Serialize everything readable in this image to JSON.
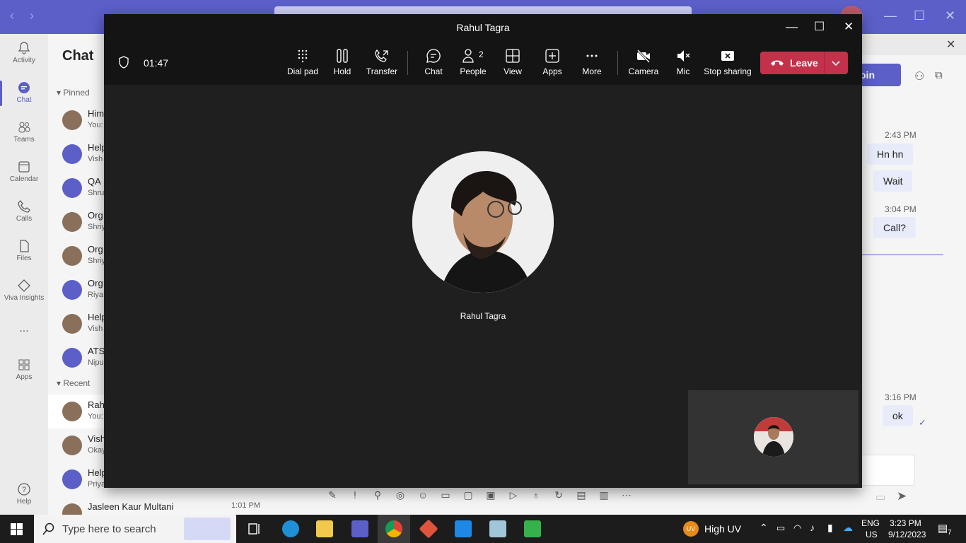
{
  "teams": {
    "rail": [
      {
        "label": "Activity",
        "icon": "bell-icon"
      },
      {
        "label": "Chat",
        "icon": "chat-icon"
      },
      {
        "label": "Teams",
        "icon": "teams-icon"
      },
      {
        "label": "Calendar",
        "icon": "calendar-icon"
      },
      {
        "label": "Calls",
        "icon": "phone-icon"
      },
      {
        "label": "Files",
        "icon": "file-icon"
      },
      {
        "label": "Viva Insights",
        "icon": "viva-icon"
      },
      {
        "label": "...",
        "icon": "more-icon"
      },
      {
        "label": "Apps",
        "icon": "apps-icon"
      },
      {
        "label": "Help",
        "icon": "help-icon"
      }
    ],
    "chat_title": "Chat",
    "pinned_label": "Pinned",
    "recent_label": "Recent",
    "pinned": [
      {
        "name": "Him",
        "preview": "You:"
      },
      {
        "name": "Help",
        "preview": "Vish"
      },
      {
        "name": "QA",
        "preview": "Shru"
      },
      {
        "name": "Org",
        "preview": "Shriy"
      },
      {
        "name": "Org",
        "preview": "Shriy"
      },
      {
        "name": "Org",
        "preview": "Riya"
      },
      {
        "name": "Help",
        "preview": "Vish"
      },
      {
        "name": "ATS",
        "preview": "Nipu"
      }
    ],
    "recent": [
      {
        "name": "Rah",
        "preview": "You:"
      },
      {
        "name": "Vish",
        "preview": "Okay"
      },
      {
        "name": "Help",
        "preview": "Priya"
      },
      {
        "name": "Jasleen Kaur Multani",
        "preview": "",
        "time": "1:01 PM"
      }
    ],
    "join_label": "oin",
    "messages": [
      {
        "time": "2:43 PM",
        "texts": [
          "Hn hn",
          "Wait"
        ]
      },
      {
        "time": "3:04 PM",
        "texts": [
          "Call?"
        ]
      },
      {
        "time": "3:16 PM",
        "texts": [
          "ok"
        ]
      }
    ]
  },
  "meeting": {
    "title": "Rahul Tagra",
    "timer": "01:47",
    "toolbar": [
      {
        "label": "Dial pad",
        "icon": "dialpad-icon"
      },
      {
        "label": "Hold",
        "icon": "pause-icon"
      },
      {
        "label": "Transfer",
        "icon": "transfer-icon"
      },
      {
        "label": "Chat",
        "icon": "chat-icon"
      },
      {
        "label": "People",
        "icon": "people-icon",
        "count": "2"
      },
      {
        "label": "View",
        "icon": "grid-icon"
      },
      {
        "label": "Apps",
        "icon": "plus-icon"
      },
      {
        "label": "More",
        "icon": "ellipsis-icon"
      },
      {
        "label": "Camera",
        "icon": "camera-off-icon"
      },
      {
        "label": "Mic",
        "icon": "mic-off-icon"
      },
      {
        "label": "Stop sharing",
        "icon": "stop-share-icon"
      }
    ],
    "leave_label": "Leave",
    "participant_name": "Rahul Tagra"
  },
  "taskbar": {
    "search_placeholder": "Type here to search",
    "weather": "High UV",
    "weather_badge": "UV",
    "lang": "ENG",
    "region": "US",
    "time": "3:23 PM",
    "date": "9/12/2023",
    "notif_count": "7"
  }
}
